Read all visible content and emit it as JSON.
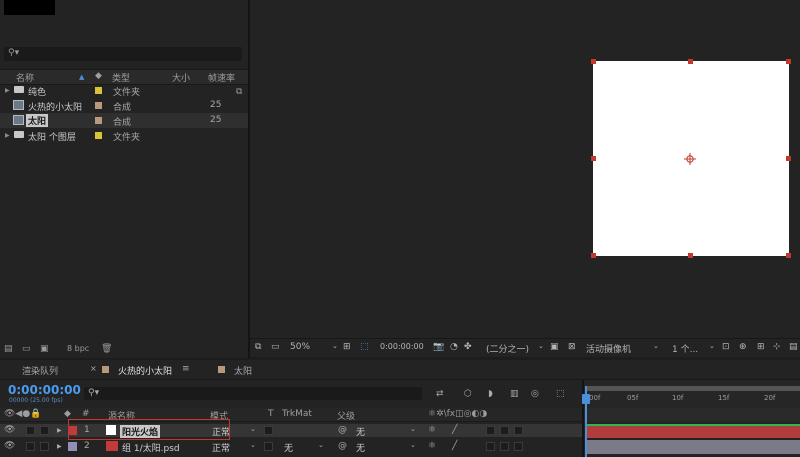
{
  "project": {
    "search_icon": "search-icon",
    "columns": {
      "name": "名称",
      "type": "类型",
      "size": "大小",
      "framerate": "帧速率"
    },
    "items": [
      {
        "label": "纯色",
        "type": "文件夹",
        "fps": "",
        "swatch": "#d8c23a",
        "kind": "folder"
      },
      {
        "label": "火热的小太阳",
        "type": "合成",
        "fps": "25",
        "swatch": "#b89a7a",
        "kind": "comp"
      },
      {
        "label": "太阳",
        "type": "合成",
        "fps": "25",
        "swatch": "#b89a7a",
        "kind": "comp"
      },
      {
        "label": "太阳 个图层",
        "type": "文件夹",
        "fps": "",
        "swatch": "#d8c23a",
        "kind": "folder"
      }
    ],
    "footer_bpc": "8 bpc"
  },
  "viewer": {
    "zoom": "50%",
    "timecode": "0:00:00:00",
    "resolution": "(二分之一)",
    "camera": "活动摄像机",
    "views": "1 个..."
  },
  "timeline": {
    "tabs": [
      {
        "label": "渲染队列"
      },
      {
        "label": "火热的小太阳"
      },
      {
        "label": "太阳"
      }
    ],
    "time_display": "0:00:00:00",
    "fps_sub": "00000 (25.00 fps)",
    "headers": {
      "name": "源名称",
      "mode": "模式",
      "t": "T",
      "trkmat": "TrkMat",
      "parent": "父级"
    },
    "ruler_ticks": [
      "00f",
      "05f",
      "10f",
      "15f",
      "20f"
    ],
    "layers": [
      {
        "num": "1",
        "name": "阳光火焰",
        "mode": "正常",
        "trkmat": "",
        "parent": "无",
        "color": "#c23b3b"
      },
      {
        "num": "2",
        "name": "组 1/太阳.psd",
        "mode": "正常",
        "trkmat": "无",
        "parent": "无",
        "color": "#8f8fb8"
      }
    ],
    "track_colors": [
      "#b23b3b",
      "#7a7a88"
    ]
  }
}
